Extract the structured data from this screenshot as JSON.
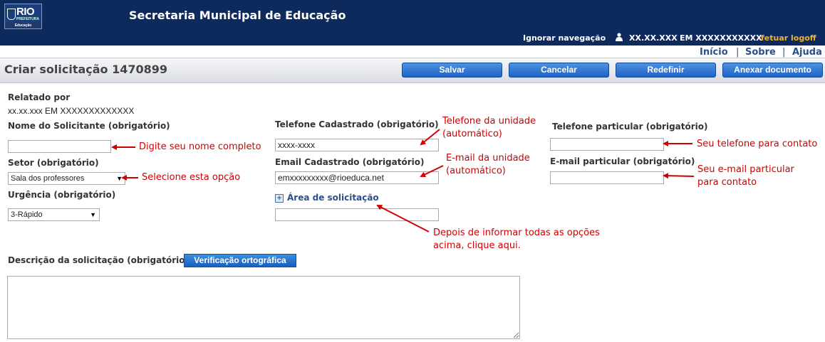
{
  "header": {
    "logo_text": "RIO",
    "logo_sub": "PREFEITURA",
    "logo_dept": "Educação",
    "app_title": "Secretaria Municipal de Educação",
    "skip_nav": "Ignorar navegação",
    "user_name": "XX.XX.XXX",
    "school_name": "EM XXXXXXXXXXX",
    "logoff": "fetuar logoff",
    "user_icon": "user-icon"
  },
  "top_links": {
    "home": "Início",
    "about": "Sobre",
    "help": "Ajuda",
    "separator": "|"
  },
  "title_bar": {
    "title": "Criar solicitação 1470899",
    "buttons": {
      "save": "Salvar",
      "cancel": "Cancelar",
      "reset": "Redefinir",
      "attach": "Anexar documento"
    }
  },
  "form": {
    "reported_by_label": "Relatado por",
    "reported_by_value": "xx.xx.xxx EM XXXXXXXXXXXXX",
    "requester_name_label": "Nome do Solicitante (obrigatório)",
    "requester_name_value": "",
    "sector_label": "Setor (obrigatório)",
    "sector_value": "Sala dos professores",
    "urgency_label": "Urgência (obrigatório)",
    "urgency_value": "3-Rápido",
    "registered_phone_label": "Telefone Cadastrado (obrigatório)",
    "registered_phone_value": "xxxx-xxxx",
    "registered_email_label": "Email Cadastrado (obrigatório)",
    "registered_email_value": "emxxxxxxxxx@rioeduca.net",
    "request_area_label": "Área de solicitação",
    "request_area_icon": "expand-plus-icon",
    "request_area_value": "",
    "private_phone_label": "Telefone particular (obrigatório)",
    "private_phone_value": "",
    "private_email_label": "E-mail particular (obrigatório)",
    "private_email_value": "",
    "description_label": "Descrição da solicitação (obrigatório)",
    "spellcheck_button": "Verificação ortográfica",
    "description_value": ""
  },
  "annotations": {
    "name_hint": "Digite seu nome completo",
    "sector_hint": "Selecione esta opção",
    "unit_phone_line1": "Telefone da unidade",
    "unit_phone_line2": "(automático)",
    "unit_email_line1": "E-mail da unidade",
    "unit_email_line2": "(automático)",
    "area_hint_line1": "Depois de informar todas as opções",
    "area_hint_line2": "acima, clique aqui.",
    "phone_hint": "Seu telefone para contato",
    "email_hint_line1": "Seu e-mail particular",
    "email_hint_line2": "para contato",
    "annotation_color": "#d00000"
  },
  "colors": {
    "header_bg": "#0e2a5c",
    "button_blue": "#1f63c6",
    "logoff": "#f0b429",
    "link": "#2b4f8a"
  }
}
